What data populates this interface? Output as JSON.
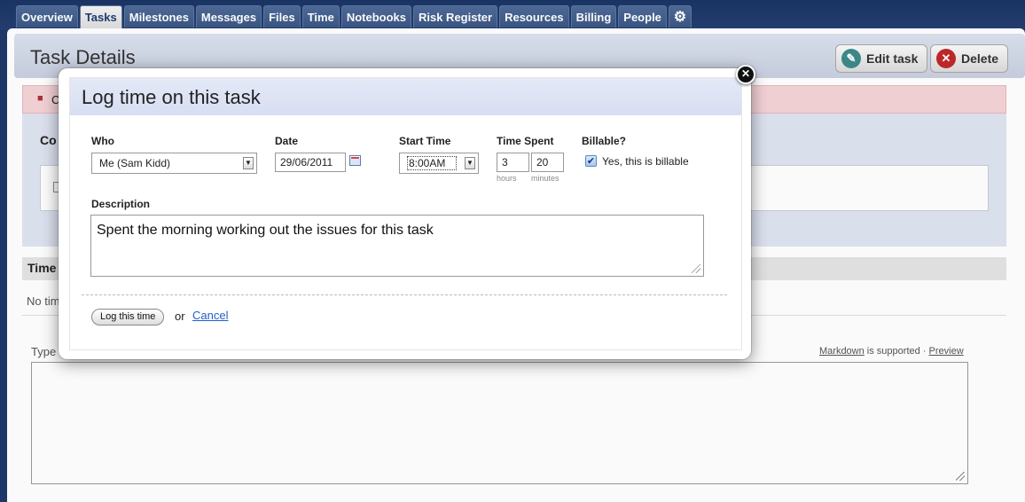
{
  "nav": {
    "tabs": [
      "Overview",
      "Tasks",
      "Milestones",
      "Messages",
      "Files",
      "Time",
      "Notebooks",
      "Risk Register",
      "Resources",
      "Billing",
      "People"
    ],
    "active_tab": "Tasks",
    "settings_icon": "gear-icon"
  },
  "page": {
    "title": "Task Details",
    "edit_button": "Edit task",
    "delete_button": "Delete",
    "alert_text": "C",
    "comments_heading": "Co",
    "time_heading": "Time",
    "no_time_text": "No tim",
    "type_label": "Type",
    "markdown_link": "Markdown",
    "markdown_suffix": " is supported · ",
    "preview_link": "Preview"
  },
  "modal": {
    "title": "Log time on this task",
    "who": {
      "label": "Who",
      "value": "Me (Sam Kidd)"
    },
    "date": {
      "label": "Date",
      "value": "29/06/2011"
    },
    "start_time": {
      "label": "Start Time",
      "value": "8:00AM"
    },
    "time_spent": {
      "label": "Time Spent",
      "hours": "3",
      "minutes": "20",
      "hours_hint": "hours",
      "minutes_hint": "minutes"
    },
    "billable": {
      "label": "Billable?",
      "checked": true,
      "option_label": "Yes, this is billable"
    },
    "description": {
      "label": "Description",
      "value": "Spent the morning working out the issues for this task"
    },
    "submit_button": "Log this time",
    "or_text": "or",
    "cancel_link": "Cancel"
  },
  "colors": {
    "nav_bg": "#1e3a6b",
    "modal_header": "#dfe4f5",
    "link": "#1f5fcf",
    "alert_bg": "#f5d4d8"
  }
}
